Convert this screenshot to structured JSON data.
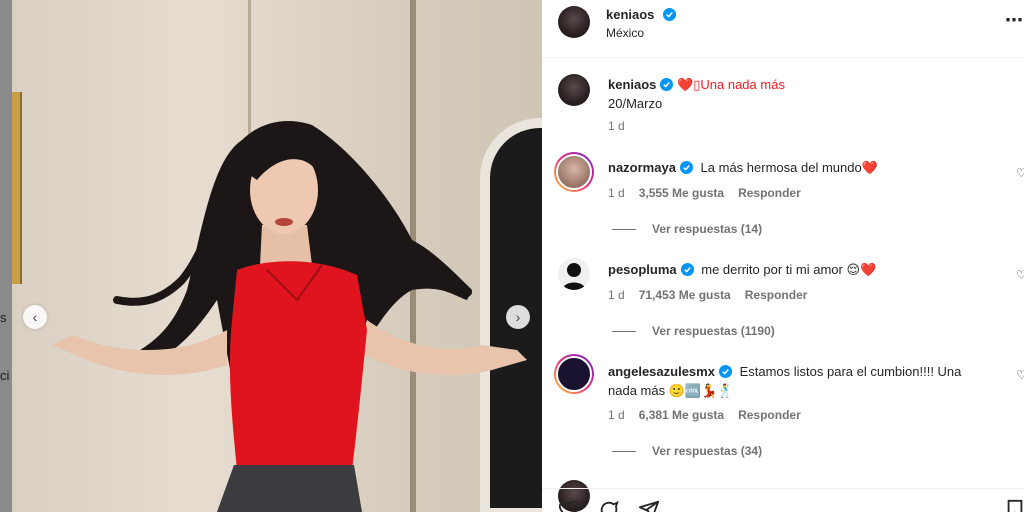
{
  "background_page": {
    "fragments": [
      "s",
      "ci"
    ]
  },
  "post": {
    "author": "keniaos",
    "location": "México",
    "caption_author": "keniaos",
    "caption_line1": "❤️▯Una nada más",
    "caption_line2": "20/Marzo",
    "caption_time": "1 d",
    "more_icon": "⋯"
  },
  "comments": [
    {
      "username": "nazormaya",
      "text": "La más hermosa del mundo❤️",
      "time": "1 d",
      "likes": "3,555 Me gusta",
      "reply": "Responder",
      "view_replies": "Ver respuestas (14)"
    },
    {
      "username": "pesopluma",
      "text": "me derrito por ti mi amor 😌❤️",
      "time": "1 d",
      "likes": "71,453 Me gusta",
      "reply": "Responder",
      "view_replies": "Ver respuestas (1190)"
    },
    {
      "username": "angelesazulesmx",
      "text_line1": "Estamos listos para el cumbion!!!! Una",
      "text_line2": "nada más 🙂🆒💃🕺",
      "time": "1 d",
      "likes": "6,381 Me gusta",
      "reply": "Responder",
      "view_replies": "Ver respuestas (34)"
    }
  ],
  "colors": {
    "verified": "#0095f6",
    "heart": "#ed1c24",
    "text_primary": "#262626",
    "text_secondary": "#737373"
  },
  "icons": [
    "verified-badge-icon",
    "heart-icon",
    "comment-icon",
    "share-icon",
    "bookmark-icon",
    "chevron-left-icon",
    "chevron-right-icon",
    "more-options-icon"
  ]
}
